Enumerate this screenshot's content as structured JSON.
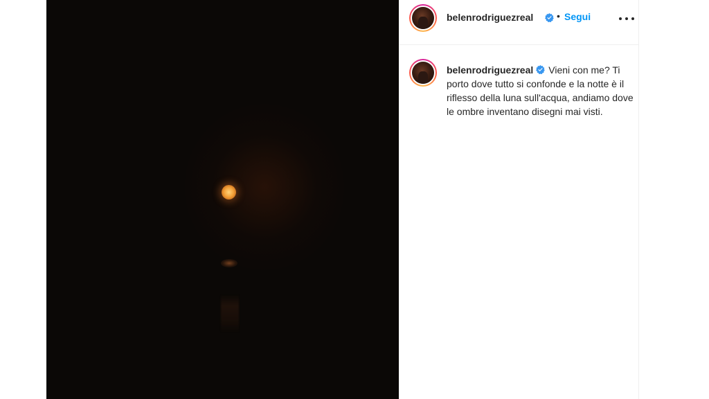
{
  "post": {
    "username": "belenrodriguezreal",
    "separator": "•",
    "follow_label": "Segui",
    "more_icon": "more-options-icon",
    "verified_icon": "verified-badge-icon",
    "caption": "Vieni con me? Ti porto dove tutto si confonde e la notte è il riflesso della luna sull'acqua, andiamo dove le ombre inventano disegni mai visti."
  },
  "colors": {
    "follow_blue": "#0095f6",
    "verified_blue": "#3897f0",
    "text": "#262626",
    "moon": "#f4a23a"
  }
}
